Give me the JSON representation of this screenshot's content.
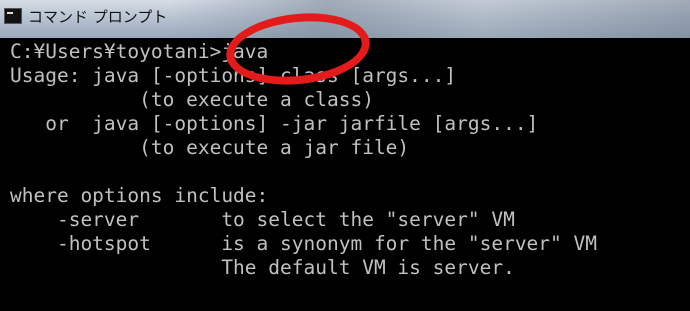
{
  "window": {
    "title": "コマンド プロンプト"
  },
  "console": {
    "lines": [
      "C:¥Users¥toyotani>java",
      "Usage: java [-options] class [args...]",
      "           (to execute a class)",
      "   or  java [-options] -jar jarfile [args...]",
      "           (to execute a jar file)",
      "",
      "where options include:",
      "    -server       to select the \"server\" VM",
      "    -hotspot      is a synonym for the \"server\" VM",
      "                  The default VM is server."
    ]
  },
  "annotation": {
    "color": "#e41b1b"
  }
}
